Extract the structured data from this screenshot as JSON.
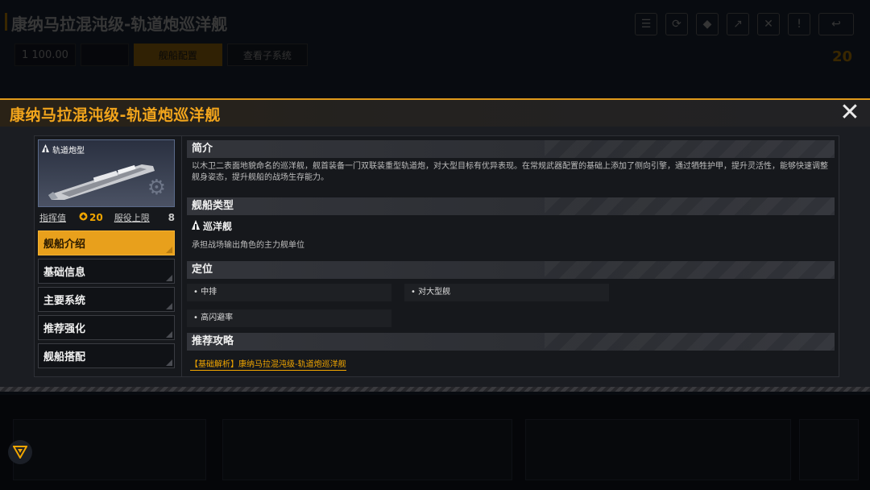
{
  "background": {
    "title": "康纳马拉混沌级-轨道炮巡洋舰",
    "stat_value": "1 100.00",
    "button_primary": "舰船配置",
    "button_secondary": "查看子系统",
    "cost": "20"
  },
  "dialog": {
    "title": "康纳马拉混沌级-轨道炮巡洋舰",
    "close_label": "✕",
    "card": {
      "type_label": "轨道炮型"
    },
    "stats": {
      "command_label": "指挥值",
      "command_value": "20",
      "service_label": "服役上限",
      "service_value": "8"
    },
    "nav": [
      {
        "label": "舰船介绍",
        "active": true
      },
      {
        "label": "基础信息",
        "active": false
      },
      {
        "label": "主要系统",
        "active": false
      },
      {
        "label": "推荐强化",
        "active": false
      },
      {
        "label": "舰船搭配",
        "active": false
      }
    ],
    "sections": {
      "intro_title": "简介",
      "intro_text": "以木卫二表面地貌命名的巡洋舰，舰首装备一门双联装重型轨道炮，对大型目标有优异表现。在常规武器配置的基础上添加了侧向引擎，通过牺牲护甲，提升灵活性，能够快速调整舰身姿态，提升舰船的战场生存能力。",
      "type_title": "舰船类型",
      "type_name": "巡洋舰",
      "type_desc": "承担战场输出角色的主力舰单位",
      "position_title": "定位",
      "positions": [
        "• 中排",
        "• 对大型舰",
        "• 高闪避率"
      ],
      "strategy_title": "推荐攻略",
      "strategy_link": "【基础解析】康纳马拉混沌级-轨道炮巡洋舰"
    }
  },
  "colors": {
    "accent": "#f0a500",
    "panel_bg": "#1b1d22",
    "active_nav": "#e8a01c"
  },
  "icons": {
    "close": "close-icon",
    "ship_type": "cruiser-icon",
    "command": "command-points-icon",
    "corner": "triangle-menu-icon"
  }
}
